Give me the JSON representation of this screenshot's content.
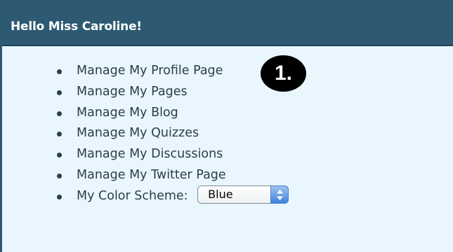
{
  "panel": {
    "title": "Hello Miss Caroline!"
  },
  "menu": {
    "items": [
      {
        "label": "Manage My Profile Page"
      },
      {
        "label": "Manage My Pages"
      },
      {
        "label": "Manage My Blog"
      },
      {
        "label": "Manage My Quizzes"
      },
      {
        "label": "Manage My Discussions"
      },
      {
        "label": "Manage My Twitter Page"
      }
    ],
    "color_scheme": {
      "label": "My Color Scheme:",
      "selected": "Blue"
    }
  },
  "annotation": {
    "badge_text": "1."
  },
  "colors": {
    "header_bg": "#2d5a72",
    "panel_bg": "#e9f6fd",
    "text": "#2b3d4b",
    "badge_bg": "#000000"
  }
}
